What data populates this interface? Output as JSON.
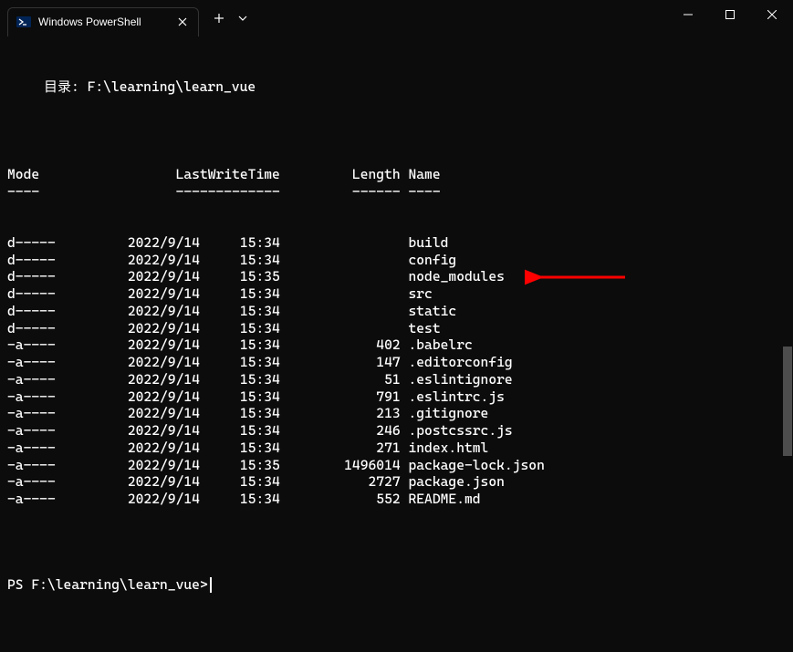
{
  "window": {
    "tab_title": "Windows PowerShell",
    "minimize": "─",
    "maximize": "□",
    "close": "✕",
    "plus": "+",
    "chevron": "⌄"
  },
  "terminal": {
    "dir_prefix": "目录: ",
    "dir_path": "F:\\learning\\learn_vue",
    "headers": {
      "mode": "Mode",
      "lwt": "LastWriteTime",
      "length": "Length",
      "name": "Name",
      "mode_u": "----",
      "lwt_u": "-------------",
      "length_u": "------",
      "name_u": "----"
    },
    "rows": [
      {
        "mode": "d-----",
        "date": "2022/9/14",
        "time": "15:34",
        "length": "",
        "name": "build"
      },
      {
        "mode": "d-----",
        "date": "2022/9/14",
        "time": "15:34",
        "length": "",
        "name": "config"
      },
      {
        "mode": "d-----",
        "date": "2022/9/14",
        "time": "15:35",
        "length": "",
        "name": "node_modules"
      },
      {
        "mode": "d-----",
        "date": "2022/9/14",
        "time": "15:34",
        "length": "",
        "name": "src"
      },
      {
        "mode": "d-----",
        "date": "2022/9/14",
        "time": "15:34",
        "length": "",
        "name": "static"
      },
      {
        "mode": "d-----",
        "date": "2022/9/14",
        "time": "15:34",
        "length": "",
        "name": "test"
      },
      {
        "mode": "-a----",
        "date": "2022/9/14",
        "time": "15:34",
        "length": "402",
        "name": ".babelrc"
      },
      {
        "mode": "-a----",
        "date": "2022/9/14",
        "time": "15:34",
        "length": "147",
        "name": ".editorconfig"
      },
      {
        "mode": "-a----",
        "date": "2022/9/14",
        "time": "15:34",
        "length": "51",
        "name": ".eslintignore"
      },
      {
        "mode": "-a----",
        "date": "2022/9/14",
        "time": "15:34",
        "length": "791",
        "name": ".eslintrc.js"
      },
      {
        "mode": "-a----",
        "date": "2022/9/14",
        "time": "15:34",
        "length": "213",
        "name": ".gitignore"
      },
      {
        "mode": "-a----",
        "date": "2022/9/14",
        "time": "15:34",
        "length": "246",
        "name": ".postcssrc.js"
      },
      {
        "mode": "-a----",
        "date": "2022/9/14",
        "time": "15:34",
        "length": "271",
        "name": "index.html"
      },
      {
        "mode": "-a----",
        "date": "2022/9/14",
        "time": "15:35",
        "length": "1496014",
        "name": "package-lock.json"
      },
      {
        "mode": "-a----",
        "date": "2022/9/14",
        "time": "15:34",
        "length": "2727",
        "name": "package.json"
      },
      {
        "mode": "-a----",
        "date": "2022/9/14",
        "time": "15:34",
        "length": "552",
        "name": "README.md"
      }
    ],
    "prompt": "PS F:\\learning\\learn_vue>"
  },
  "annotation": {
    "arrow_color": "#ff0000",
    "arrow_target_row": 2
  }
}
